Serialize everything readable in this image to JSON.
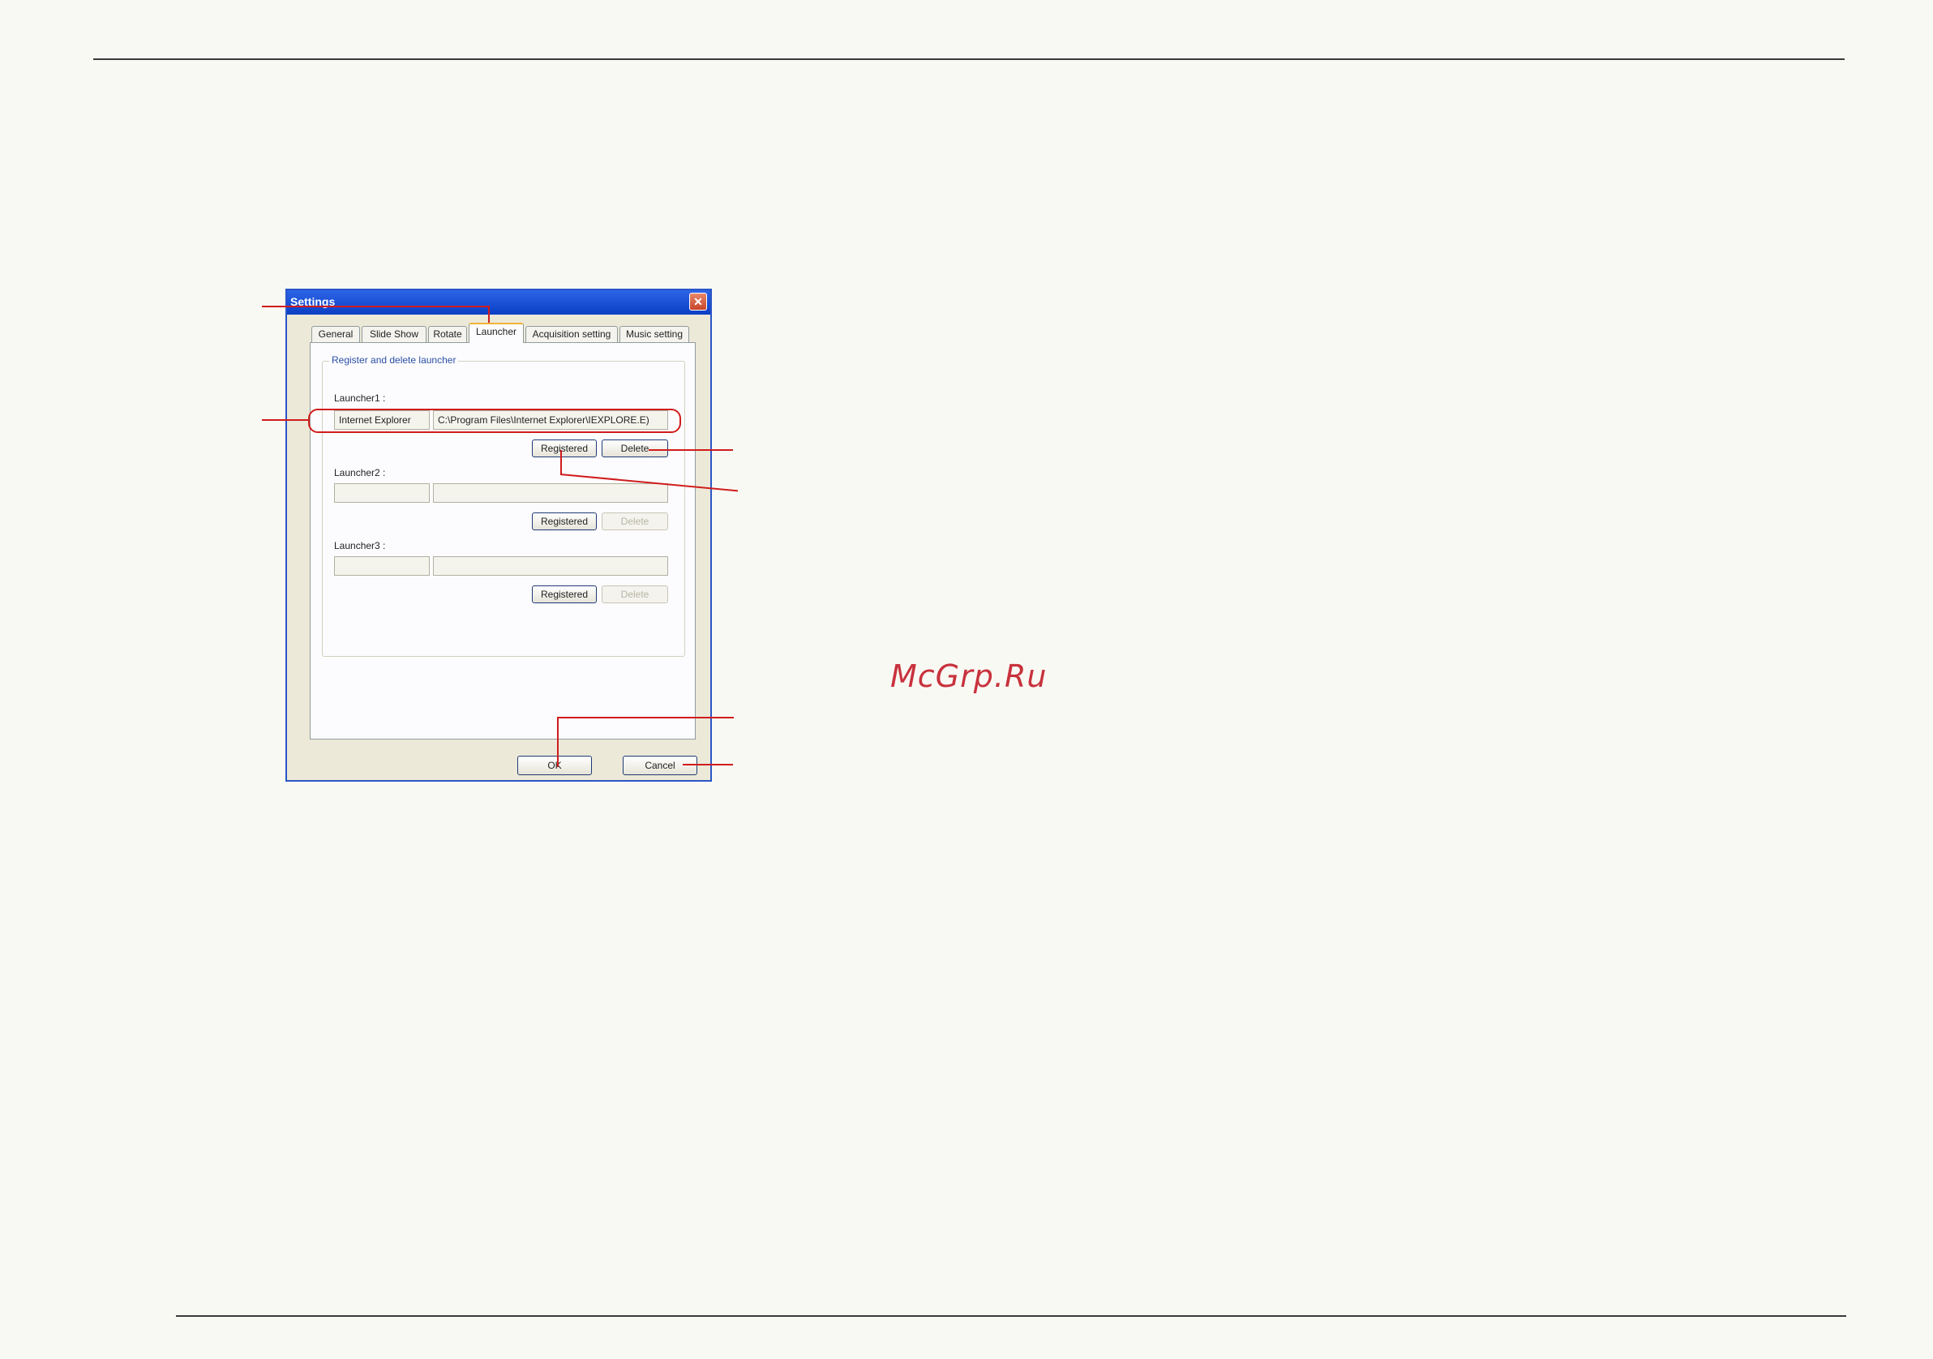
{
  "dialog": {
    "title": "Settings",
    "close_glyph": "✕",
    "tabs": [
      {
        "label": "General"
      },
      {
        "label": "Slide Show"
      },
      {
        "label": "Rotate"
      },
      {
        "label": "Launcher"
      },
      {
        "label": "Acquisition setting"
      },
      {
        "label": "Music setting"
      }
    ],
    "active_tab": "Launcher",
    "group_title": "Register and delete launcher",
    "launchers": [
      {
        "label": "Launcher1 :",
        "name": "Internet Explorer",
        "path": "C:\\Program Files\\Internet Explorer\\IEXPLORE.E)",
        "register_label": "Registered",
        "delete_label": "Delete",
        "delete_enabled": true
      },
      {
        "label": "Launcher2 :",
        "name": "",
        "path": "",
        "register_label": "Registered",
        "delete_label": "Delete",
        "delete_enabled": false
      },
      {
        "label": "Launcher3 :",
        "name": "",
        "path": "",
        "register_label": "Registered",
        "delete_label": "Delete",
        "delete_enabled": false
      }
    ],
    "ok_label": "OK",
    "cancel_label": "Cancel"
  },
  "watermark": "McGrp.Ru",
  "colors": {
    "callout": "#d01c1c",
    "titlebar": "#0a3fc4",
    "dialog_bg": "#ece9d8",
    "page_bg": "#f9f9f4"
  }
}
